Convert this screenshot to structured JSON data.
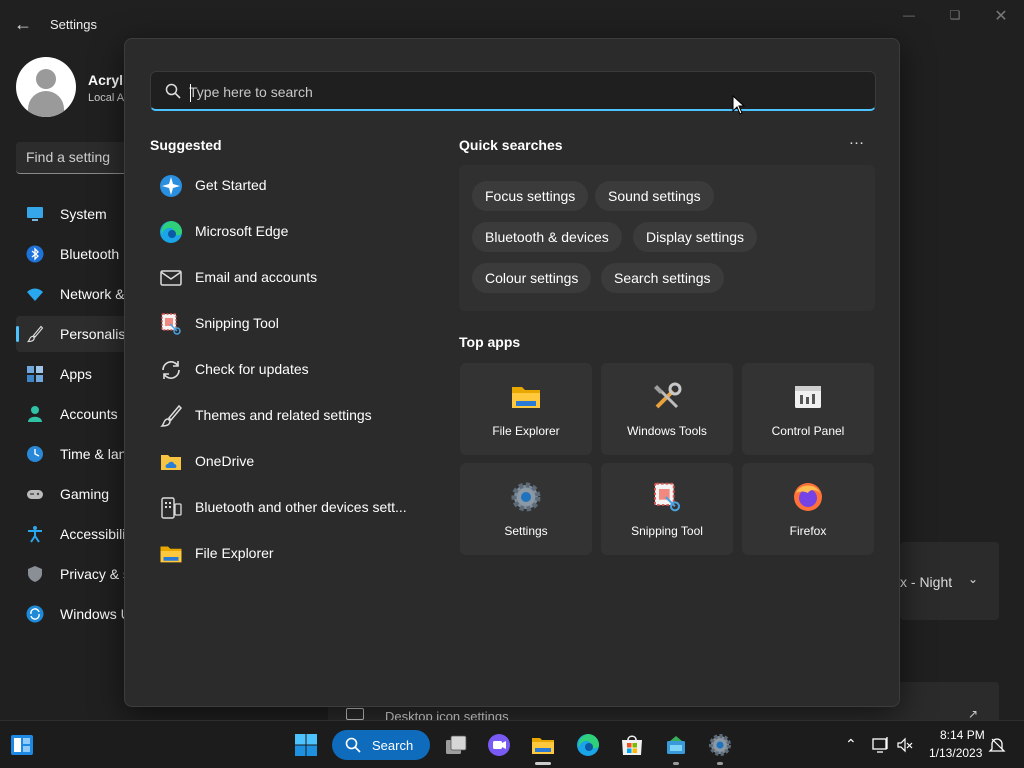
{
  "settings": {
    "title": "Settings",
    "profile": {
      "name": "Acrylic",
      "sub": "Local A"
    },
    "find_placeholder": "Find a setting",
    "nav": [
      {
        "label": "System",
        "icon": "monitor-icon"
      },
      {
        "label": "Bluetooth",
        "icon": "bluetooth-icon"
      },
      {
        "label": "Network &",
        "icon": "wifi-icon"
      },
      {
        "label": "Personalisa",
        "icon": "brush-icon",
        "active": true
      },
      {
        "label": "Apps",
        "icon": "apps-icon"
      },
      {
        "label": "Accounts",
        "icon": "person-icon"
      },
      {
        "label": "Time & lan",
        "icon": "clock-globe-icon"
      },
      {
        "label": "Gaming",
        "icon": "gamepad-icon"
      },
      {
        "label": "Accessibilit",
        "icon": "accessibility-icon"
      },
      {
        "label": "Privacy & s",
        "icon": "shield-icon"
      },
      {
        "label": "Windows U",
        "icon": "update-icon"
      }
    ],
    "theme_card_text": "x - Night",
    "desktop_icon_row": "Desktop icon settings"
  },
  "search": {
    "placeholder": "Type here to search",
    "suggested_title": "Suggested",
    "suggested": [
      {
        "label": "Get Started",
        "icon": "get-started-icon"
      },
      {
        "label": "Microsoft Edge",
        "icon": "edge-icon"
      },
      {
        "label": "Email and accounts",
        "icon": "mail-icon"
      },
      {
        "label": "Snipping Tool",
        "icon": "snipping-tool-icon"
      },
      {
        "label": "Check for updates",
        "icon": "refresh-icon"
      },
      {
        "label": "Themes and related settings",
        "icon": "brush-icon"
      },
      {
        "label": "OneDrive",
        "icon": "onedrive-folder-icon"
      },
      {
        "label": "Bluetooth and other devices sett...",
        "icon": "keyboard-device-icon"
      },
      {
        "label": "File Explorer",
        "icon": "folder-icon"
      }
    ],
    "quick_title": "Quick searches",
    "quick": [
      "Focus settings",
      "Sound settings",
      "Bluetooth & devices",
      "Display settings",
      "Colour settings",
      "Search settings"
    ],
    "top_apps_title": "Top apps",
    "top_apps": [
      {
        "label": "File Explorer",
        "icon": "folder-icon"
      },
      {
        "label": "Windows Tools",
        "icon": "tools-icon"
      },
      {
        "label": "Control Panel",
        "icon": "control-panel-icon"
      },
      {
        "label": "Settings",
        "icon": "gear-icon"
      },
      {
        "label": "Snipping Tool",
        "icon": "snipping-tool-icon"
      },
      {
        "label": "Firefox",
        "icon": "firefox-icon"
      }
    ]
  },
  "taskbar": {
    "search_label": "Search",
    "time": "8:14 PM",
    "date": "1/13/2023"
  },
  "colors": {
    "accent": "#4cc2ff",
    "taskbar_search": "#0f6cbd"
  }
}
